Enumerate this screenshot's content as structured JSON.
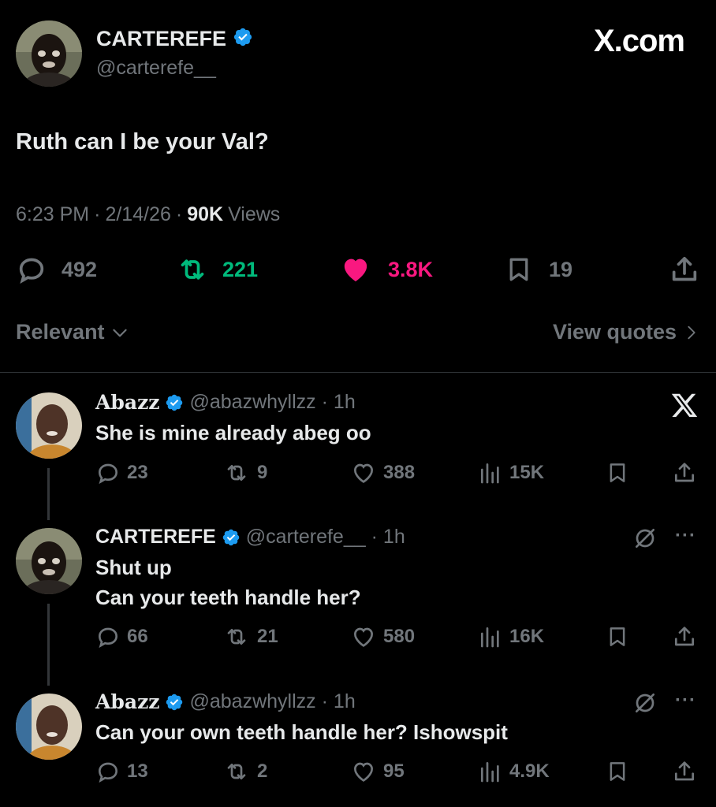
{
  "post": {
    "author_name": "CARTEREFE",
    "author_handle": "@carterefe__",
    "brand": "X.com",
    "text": "Ruth can I be your Val?",
    "time": "6:23 PM",
    "date": "2/14/26",
    "views_count": "90K",
    "views_label": "Views",
    "sep": "·",
    "stats": {
      "replies": "492",
      "reposts": "221",
      "likes": "3.8K",
      "bookmarks": "19"
    },
    "colors": {
      "repost": "#00ba7c",
      "like": "#f91880",
      "verified": "#1d9bf0"
    }
  },
  "filters": {
    "sort_label": "Relevant",
    "view_quotes_label": "View quotes"
  },
  "replies": [
    {
      "author_name": "Abazz",
      "author_handle": "@abazwhyllzz",
      "time": "· 1h",
      "text_lines": [
        "She is mine already abeg oo"
      ],
      "stats": {
        "replies": "23",
        "reposts": "9",
        "likes": "388",
        "views": "15K"
      },
      "top_right_icon": "x-logo-icon"
    },
    {
      "author_name": "CARTEREFE",
      "author_handle": "@carterefe__",
      "time": "· 1h",
      "text_lines": [
        "Shut up",
        "Can your teeth handle her?"
      ],
      "stats": {
        "replies": "66",
        "reposts": "21",
        "likes": "580",
        "views": "16K"
      },
      "top_right_icon": "grok-icon",
      "more": "···"
    },
    {
      "author_name": "Abazz",
      "author_handle": "@abazwhyllzz",
      "time": "· 1h",
      "text_lines": [
        "Can your own teeth handle her? Ishowspit"
      ],
      "stats": {
        "replies": "13",
        "reposts": "2",
        "likes": "95",
        "views": "4.9K"
      },
      "top_right_icon": "grok-icon",
      "more": "···"
    }
  ]
}
